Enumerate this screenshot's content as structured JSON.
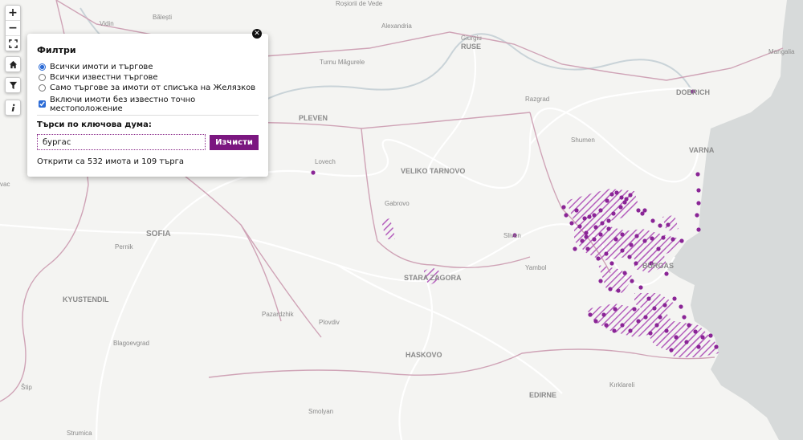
{
  "map": {
    "colors": {
      "land": "#f4f4f2",
      "sea": "#d7dada",
      "border": "#cfa3b6",
      "road": "#ffffff",
      "marker": "#8a2596",
      "hatch": "#b560bd"
    },
    "cities": [
      {
        "id": "rosiorii",
        "name": "Roșiorii de Vede"
      },
      {
        "id": "balesti",
        "name": "Bălești"
      },
      {
        "id": "vidin",
        "name": "Vidin"
      },
      {
        "id": "alexandria",
        "name": "Alexandria"
      },
      {
        "id": "giurgiu",
        "name": "Giurgiu"
      },
      {
        "id": "ruse",
        "name": "RUSE"
      },
      {
        "id": "turnu",
        "name": "Turnu Măgurele"
      },
      {
        "id": "mangalia",
        "name": "Mangalia"
      },
      {
        "id": "dobrich",
        "name": "DOBRICH"
      },
      {
        "id": "razgrad",
        "name": "Razgrad"
      },
      {
        "id": "pleven",
        "name": "PLEVEN"
      },
      {
        "id": "shumen",
        "name": "Shumen"
      },
      {
        "id": "varna",
        "name": "VARNA"
      },
      {
        "id": "lovech",
        "name": "Lovech"
      },
      {
        "id": "veliko",
        "name": "VELIKO TARNOVO"
      },
      {
        "id": "gabrovo",
        "name": "Gabrovo"
      },
      {
        "id": "sofia",
        "name": "SOFIA"
      },
      {
        "id": "sliven",
        "name": "Sliven"
      },
      {
        "id": "pernik",
        "name": "Pernik"
      },
      {
        "id": "yambol",
        "name": "Yambol"
      },
      {
        "id": "burgas",
        "name": "BURGAS"
      },
      {
        "id": "stara",
        "name": "STARA ZAGORA"
      },
      {
        "id": "kyustendil",
        "name": "KYUSTENDIL"
      },
      {
        "id": "pazardzhik",
        "name": "Pazardzhik"
      },
      {
        "id": "plovdiv",
        "name": "Plovdiv"
      },
      {
        "id": "blagoevgrad",
        "name": "Blagoevgrad"
      },
      {
        "id": "haskovo",
        "name": "HASKOVO"
      },
      {
        "id": "edirne",
        "name": "EDIRNE"
      },
      {
        "id": "kirklareli",
        "name": "Kırklareli"
      },
      {
        "id": "stip",
        "name": "Štip"
      },
      {
        "id": "smolyan",
        "name": "Smolyan"
      },
      {
        "id": "strumica",
        "name": "Strumica"
      },
      {
        "id": "vac",
        "name": "vac"
      }
    ]
  },
  "controls": {
    "zoom_in": "+",
    "zoom_out": "−",
    "fullscreen_icon": "fullscreen-icon",
    "home_icon": "home-icon",
    "filter_icon": "filter-icon",
    "info_icon": "info-icon"
  },
  "filters": {
    "title": "Филтри",
    "options": [
      {
        "label": "Всички имоти и търгове",
        "checked": true
      },
      {
        "label": "Всички известни търгове",
        "checked": false
      },
      {
        "label": "Само търгове за имоти от списъка на Желязков",
        "checked": false
      }
    ],
    "include_unknown": {
      "label": "Включи имоти без известно точно местоположение",
      "checked": true
    },
    "search_label": "Търси по ключова дума:",
    "search_value": "бургас",
    "clear_label": "Изчисти",
    "result_text": "Открити са 532 имота и 109 търга",
    "close_icon": "close-icon"
  }
}
